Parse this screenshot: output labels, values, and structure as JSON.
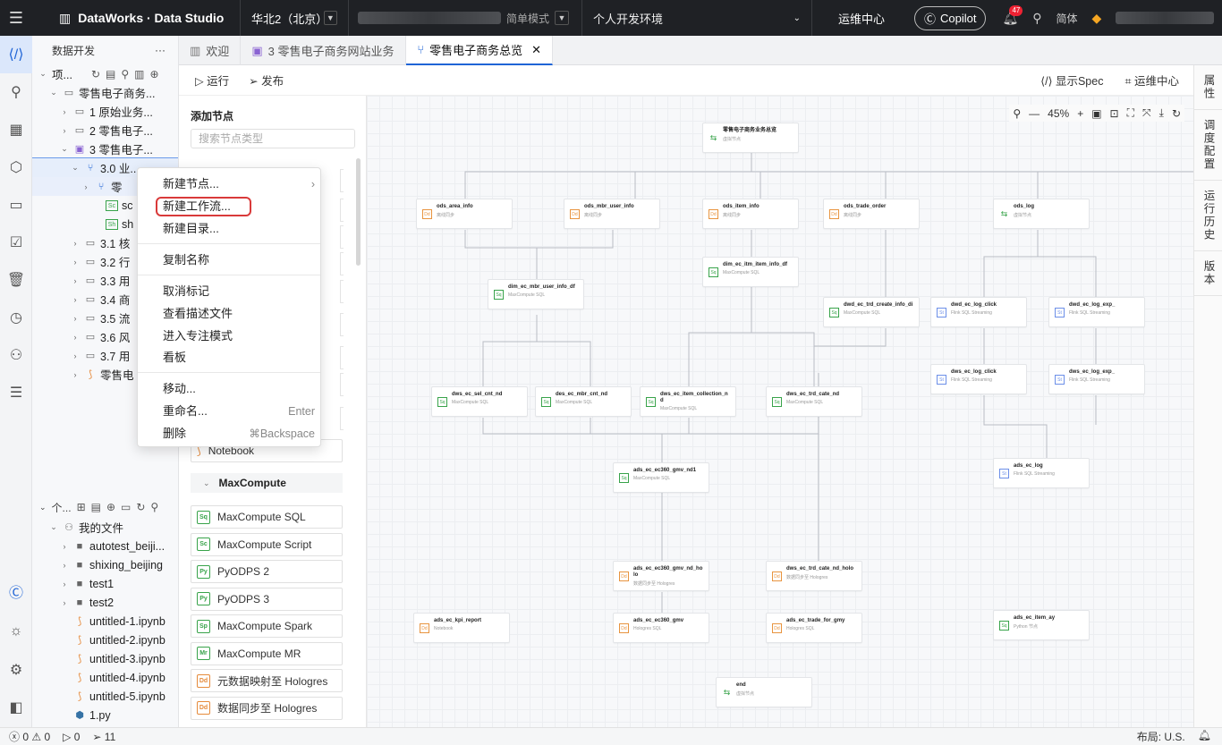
{
  "topbar": {
    "app_title": "DataWorks · Data Studio",
    "region": "华北2（北京）",
    "mode": "简单模式",
    "env": "个人开发环境",
    "ops_center": "运维中心",
    "copilot": "Copilot",
    "notif_count": "47",
    "lang": "简体"
  },
  "tree": {
    "header": "数据开发",
    "more": "···",
    "project_label": "项...",
    "rows": [
      {
        "label": "零售电子商务...",
        "indent": 1,
        "icon": "folder"
      },
      {
        "label": "1 原始业务...",
        "indent": 2,
        "icon": "folder"
      },
      {
        "label": "2 零售电子...",
        "indent": 2,
        "icon": "folder"
      },
      {
        "label": "3 零售电子...",
        "indent": 2,
        "icon": "workflow"
      },
      {
        "label": "3.0 业...",
        "indent": 3,
        "icon": "flow"
      },
      {
        "label": "零",
        "indent": 4,
        "icon": "flow"
      },
      {
        "label": "sc",
        "indent": 5,
        "icon": "sc"
      },
      {
        "label": "sh",
        "indent": 5,
        "icon": "sh"
      },
      {
        "label": "3.1 核",
        "indent": 3,
        "icon": "folder"
      },
      {
        "label": "3.2 行",
        "indent": 3,
        "icon": "folder"
      },
      {
        "label": "3.3 用",
        "indent": 3,
        "icon": "folder"
      },
      {
        "label": "3.4 商",
        "indent": 3,
        "icon": "folder"
      },
      {
        "label": "3.5 流",
        "indent": 3,
        "icon": "folder"
      },
      {
        "label": "3.6 风",
        "indent": 3,
        "icon": "folder"
      },
      {
        "label": "3.7 用",
        "indent": 3,
        "icon": "folder"
      },
      {
        "label": "零售电",
        "indent": 3,
        "icon": "nb"
      }
    ],
    "bottom_header": "个...",
    "my_files": "我的文件",
    "files": [
      "autotest_beiji...",
      "shixing_beijing",
      "test1",
      "test2",
      "untitled-1.ipynb",
      "untitled-2.ipynb",
      "untitled-3.ipynb",
      "untitled-4.ipynb",
      "untitled-5.ipynb",
      "1.py"
    ]
  },
  "tabs": [
    {
      "label": "欢迎",
      "active": false
    },
    {
      "label": "3 零售电子商务网站业务",
      "active": false
    },
    {
      "label": "零售电子商务总览",
      "active": true
    }
  ],
  "toolbar": {
    "run": "运行",
    "publish": "发布",
    "spec": "显示Spec",
    "ops": "运维中心"
  },
  "right_rail": [
    "属性",
    "调度配置",
    "运行历史",
    "版本"
  ],
  "palette": {
    "title": "添加节点",
    "search_placeholder": "搜索节点类型",
    "notebook": "Notebook",
    "group": "MaxCompute",
    "items": [
      {
        "label": "MaxCompute SQL",
        "icon": "Sq"
      },
      {
        "label": "MaxCompute Script",
        "icon": "Sc"
      },
      {
        "label": "PyODPS 2",
        "icon": "Py"
      },
      {
        "label": "PyODPS 3",
        "icon": "Py"
      },
      {
        "label": "MaxCompute Spark",
        "icon": "Sp"
      },
      {
        "label": "MaxCompute MR",
        "icon": "Mr"
      },
      {
        "label": "元数据映射至 Hologres",
        "icon": "Dd"
      },
      {
        "label": "数据同步至 Hologres",
        "icon": "Dd"
      }
    ]
  },
  "canvas": {
    "zoom": "45%",
    "nodes": [
      {
        "id": "root",
        "name": "零售电子商务业务总览",
        "type": "虚拟节点",
        "icon": "vir"
      },
      {
        "id": "n1",
        "name": "ods_area_info",
        "type": "离线同步",
        "icon": "or"
      },
      {
        "id": "n2",
        "name": "ods_mbr_user_info",
        "type": "离线同步",
        "icon": "or"
      },
      {
        "id": "n3",
        "name": "ods_item_info",
        "type": "离线同步",
        "icon": "or"
      },
      {
        "id": "n4",
        "name": "ods_trade_order",
        "type": "离线同步",
        "icon": "or"
      },
      {
        "id": "n5",
        "name": "ods_log",
        "type": "虚拟节点",
        "icon": "vir"
      },
      {
        "id": "n6",
        "name": "dim_ec_itm_item_info_df",
        "type": "MaxCompute SQL",
        "icon": "sq"
      },
      {
        "id": "n7",
        "name": "dim_ec_mbr_user_info_df",
        "type": "MaxCompute SQL",
        "icon": "sq"
      },
      {
        "id": "n8",
        "name": "dwd_ec_trd_create_info_di",
        "type": "MaxCompute SQL",
        "icon": "sq"
      },
      {
        "id": "n9",
        "name": "dwd_ec_log_click",
        "type": "Flink SQL Streaming",
        "icon": "bl"
      },
      {
        "id": "n10",
        "name": "dwd_ec_log_exp_",
        "type": "Flink SQL Streaming",
        "icon": "bl"
      },
      {
        "id": "n11",
        "name": "dws_ec_log_click",
        "type": "Flink SQL Streaming",
        "icon": "bl"
      },
      {
        "id": "n12",
        "name": "dws_ec_log_exp_",
        "type": "Flink SQL Streaming",
        "icon": "bl"
      },
      {
        "id": "n13",
        "name": "dws_ec_sel_cnt_nd",
        "type": "MaxCompute SQL",
        "icon": "sq"
      },
      {
        "id": "n14",
        "name": "des_ec_mbr_cnt_nd",
        "type": "MaxCompute SQL",
        "icon": "sq"
      },
      {
        "id": "n15",
        "name": "dws_ec_item_collection_nd",
        "type": "MaxCompute SQL",
        "icon": "sq"
      },
      {
        "id": "n16",
        "name": "dws_ec_trd_cate_nd",
        "type": "MaxCompute SQL",
        "icon": "sq"
      },
      {
        "id": "n17",
        "name": "ads_ec_log",
        "type": "Flink SQL Streaming",
        "icon": "bl"
      },
      {
        "id": "n18",
        "name": "ads_ec_ec360_gmv_nd1",
        "type": "MaxCompute SQL",
        "icon": "sq"
      },
      {
        "id": "n19",
        "name": "ads_ec_ec360_gmv_nd_holo",
        "type": "数据同步至 Hologres",
        "icon": "or"
      },
      {
        "id": "n20",
        "name": "dws_ec_trd_cate_nd_holo",
        "type": "数据同步至 Hologres",
        "icon": "or"
      },
      {
        "id": "n21",
        "name": "ads_ec_kpi_report",
        "type": "Notebook",
        "icon": "or"
      },
      {
        "id": "n22",
        "name": "ads_ec_ec360_gmv",
        "type": "Hologres SQL",
        "icon": "or"
      },
      {
        "id": "n23",
        "name": "ads_ec_trade_for_gmy",
        "type": "Hologres SQL",
        "icon": "or"
      },
      {
        "id": "n24",
        "name": "ads_ec_item_ay",
        "type": "Python 节点",
        "icon": "sq"
      },
      {
        "id": "n25",
        "name": "end",
        "type": "虚拟节点",
        "icon": "vir"
      }
    ]
  },
  "context_menu": {
    "new_node": "新建节点...",
    "new_workflow": "新建工作流...",
    "new_dir": "新建目录...",
    "copy_name": "复制名称",
    "unmark": "取消标记",
    "view_desc": "查看描述文件",
    "focus": "进入专注模式",
    "board": "看板",
    "move": "移动...",
    "rename": "重命名...",
    "rename_sc": "Enter",
    "delete": "删除",
    "delete_sc": "⌘Backspace"
  },
  "status": {
    "errors": "0",
    "warnings": "0",
    "runs": "0",
    "tasks": "11",
    "layout": "布局: U.S."
  }
}
